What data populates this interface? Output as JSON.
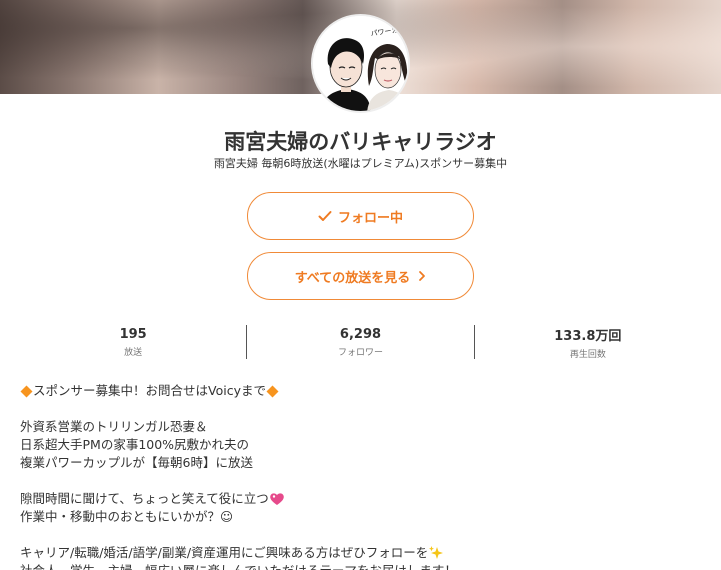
{
  "channel": {
    "title": "雨宮夫婦のバリキャリラジオ",
    "subtitle": "雨宮夫婦 毎朝6時放送(水曜はプレミアム)スポンサー募集中",
    "avatar_caption": "パワーカップル研究"
  },
  "buttons": {
    "follow_label": "フォロー中",
    "all_broadcasts_label": "すべての放送を見る"
  },
  "stats": [
    {
      "value": "195",
      "label": "放送"
    },
    {
      "value": "6,298",
      "label": "フォロワー"
    },
    {
      "value": "133.8万回",
      "label": "再生回数"
    }
  ],
  "description": {
    "line1": "スポンサー募集中！お問合せはVoicyまで",
    "line2": "外資系営業のトリリンガル恐妻＆",
    "line3": "日系超大手PMの家事100%尻敷かれ夫の",
    "line4": "複業パワーカップルが【毎朝6時】に放送",
    "line5": "隙間時間に聞けて、ちょっと笑えて役に立つ",
    "line6": "作業中・移動中のおともにいかが？☺",
    "line7": "キャリア/転職/婚活/語学/副業/資産運用にご興味ある方はぜひフォローを",
    "line8": "社会人、学生、主婦、幅広い層に楽しんでいただけるテーマをお届けします！"
  },
  "icons": {
    "follow": "check-icon",
    "all": "chevron-right-icon",
    "sponsor": "orange-diamond-icon",
    "heart": "sparkling-heart-icon",
    "sparkle": "sparkles-icon"
  },
  "colors": {
    "accent": "#ef7b22",
    "text": "#333333",
    "muted": "#777777"
  }
}
